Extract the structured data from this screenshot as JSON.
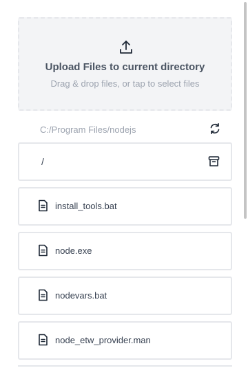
{
  "upload": {
    "icon": "upload-icon",
    "title": "Upload Files to current directory",
    "subtitle": "Drag & drop files, or tap to select files"
  },
  "path": {
    "current": "C:/Program Files/nodejs",
    "refresh_icon": "refresh-icon"
  },
  "root": {
    "label": "/",
    "icon": "archive-icon"
  },
  "files": [
    {
      "name": "install_tools.bat",
      "icon": "file-icon"
    },
    {
      "name": "node.exe",
      "icon": "file-icon"
    },
    {
      "name": "nodevars.bat",
      "icon": "file-icon"
    },
    {
      "name": "node_etw_provider.man",
      "icon": "file-icon"
    }
  ],
  "colors": {
    "border": "#e5e7eb",
    "upload_bg": "#f3f4f6",
    "muted_text": "#9ca3af",
    "text": "#374151"
  }
}
